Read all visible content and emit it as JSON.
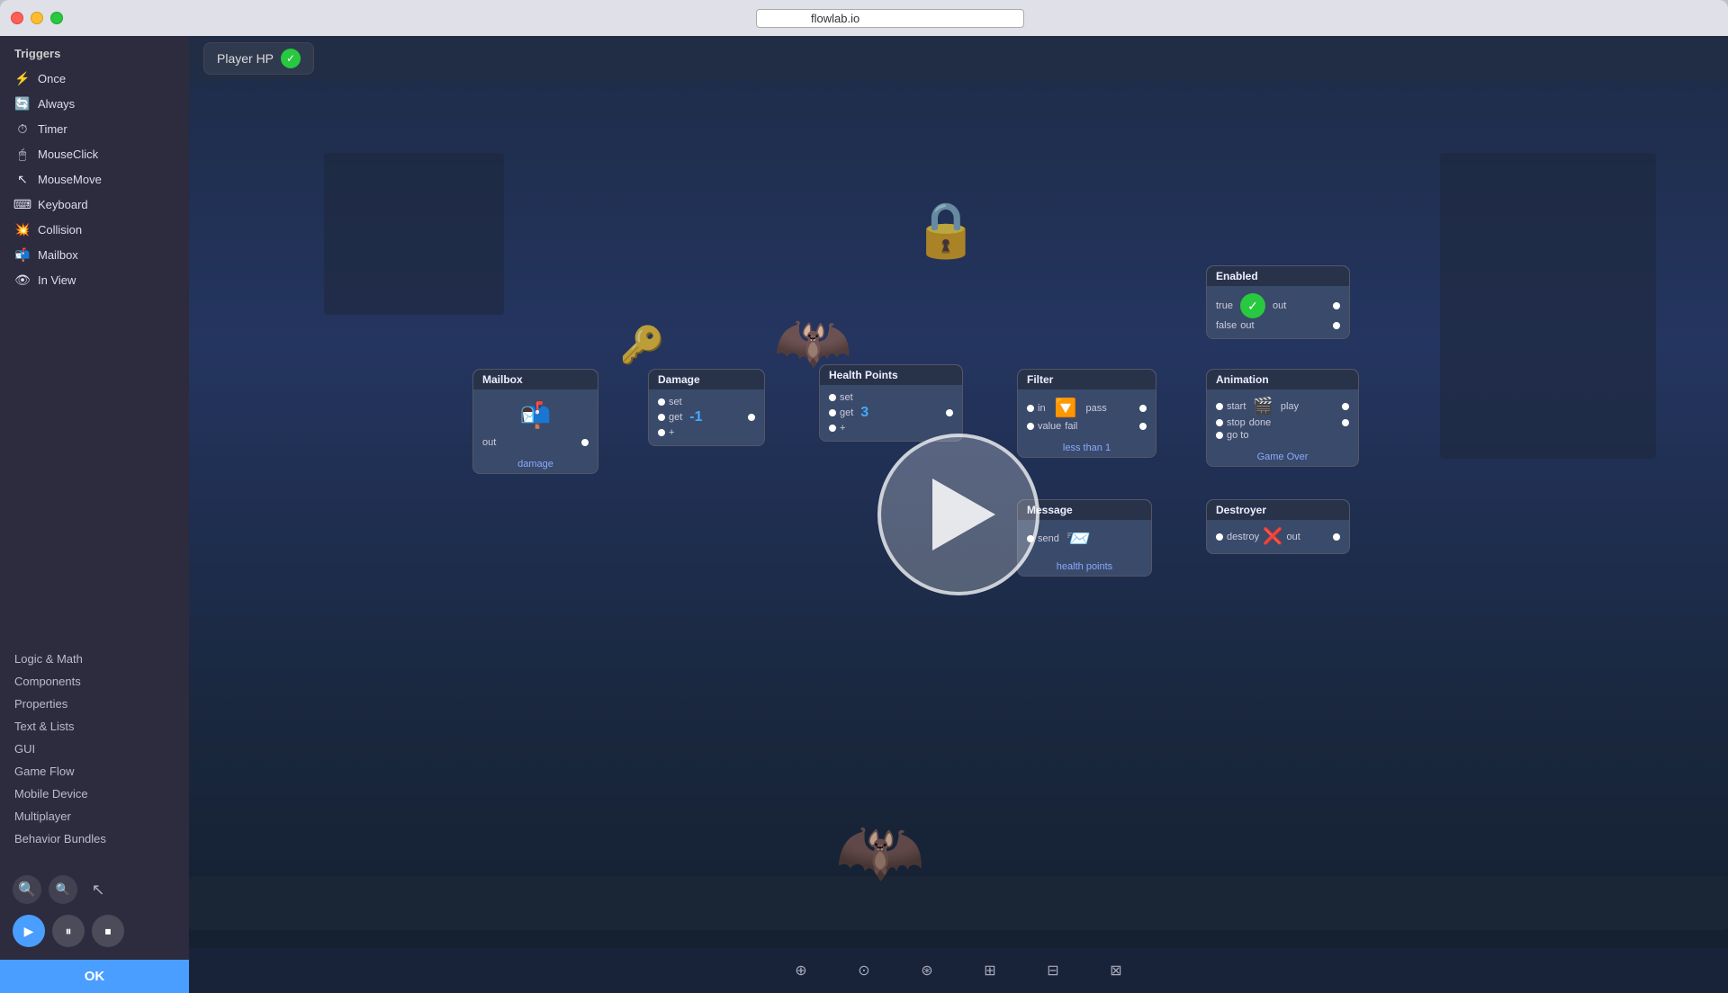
{
  "window": {
    "title": "flowlab.io",
    "title_input_value": "flowlab.io"
  },
  "sidebar": {
    "section_title": "Triggers",
    "triggers": [
      {
        "id": "once",
        "label": "Once",
        "icon": "⚡"
      },
      {
        "id": "always",
        "label": "Always",
        "icon": "🔄"
      },
      {
        "id": "timer",
        "label": "Timer",
        "icon": "⏱"
      },
      {
        "id": "mouseclick",
        "label": "MouseClick",
        "icon": "🖱"
      },
      {
        "id": "mousemove",
        "label": "MouseMove",
        "icon": "↖"
      },
      {
        "id": "keyboard",
        "label": "Keyboard",
        "icon": "⌨"
      },
      {
        "id": "collision",
        "label": "Collision",
        "icon": "💥"
      },
      {
        "id": "mailbox",
        "label": "Mailbox",
        "icon": "📬"
      },
      {
        "id": "inview",
        "label": "In View",
        "icon": "👁"
      }
    ],
    "categories": [
      {
        "id": "logic-math",
        "label": "Logic & Math"
      },
      {
        "id": "components",
        "label": "Components"
      },
      {
        "id": "properties",
        "label": "Properties"
      },
      {
        "id": "text-lists",
        "label": "Text & Lists"
      },
      {
        "id": "gui",
        "label": "GUI"
      },
      {
        "id": "game-flow",
        "label": "Game Flow"
      },
      {
        "id": "mobile-device",
        "label": "Mobile Device"
      },
      {
        "id": "multiplayer",
        "label": "Multiplayer"
      },
      {
        "id": "behavior-bundles",
        "label": "Behavior Bundles"
      }
    ],
    "ok_label": "OK"
  },
  "canvas": {
    "player_hp": {
      "label": "Player HP",
      "check": "✓"
    },
    "nodes": {
      "mailbox": {
        "title": "Mailbox",
        "ports_out": [
          "out"
        ],
        "label": "damage"
      },
      "damage": {
        "title": "Damage",
        "ports_in": [
          "set",
          "get",
          "+"
        ],
        "value": "-1",
        "ports_out": [
          "out"
        ]
      },
      "health_points": {
        "title": "Health Points",
        "ports_in": [
          "set",
          "get",
          "+"
        ],
        "value": "3",
        "ports_out": [
          "out"
        ]
      },
      "filter": {
        "title": "Filter",
        "ports_in": [
          "in",
          "value"
        ],
        "ports_out": [
          "pass",
          "fail"
        ],
        "label": "less than 1"
      },
      "enabled": {
        "title": "Enabled",
        "ports_out": [
          "out",
          "out"
        ],
        "values": [
          "true",
          "false"
        ]
      },
      "animation": {
        "title": "Animation",
        "ports_in": [
          "start",
          "stop",
          "go to"
        ],
        "ports_out": [
          "play",
          "done"
        ],
        "label": "Game Over"
      },
      "message": {
        "title": "Message",
        "ports_in": [
          "send"
        ],
        "label": "health points"
      },
      "destroyer": {
        "title": "Destroyer",
        "ports_in": [
          "destroy"
        ],
        "ports_out": [
          "out"
        ]
      }
    }
  },
  "playback": {
    "play_icon": "▶",
    "pause_icon": "⏸",
    "stop_icon": "⏹"
  },
  "zoom": {
    "zoom_in": "+",
    "zoom_out": "−",
    "reset": "⊙"
  }
}
